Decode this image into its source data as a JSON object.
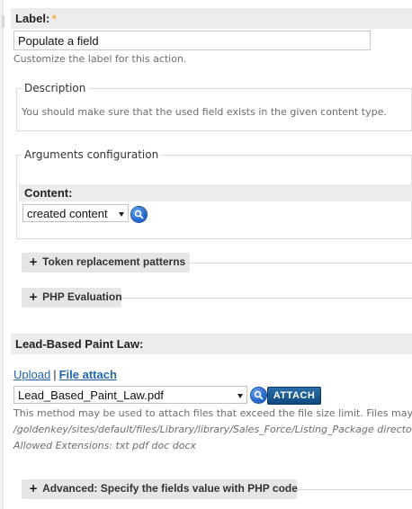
{
  "label_field": {
    "label": "Label:",
    "required_marker": "*",
    "value": "Populate a field",
    "help": "Customize the label for this action."
  },
  "description": {
    "legend": "Description",
    "text": "You should make sure that the used field exists in the given content type."
  },
  "arguments": {
    "legend": "Arguments configuration",
    "content_label": "Content:",
    "content_select_value": "created content"
  },
  "collapsibles": {
    "token": "Token replacement patterns",
    "php_eval": "PHP Evaluation",
    "advanced": "Advanced: Specify the fields value with PHP code"
  },
  "attachment": {
    "section_label": "Lead-Based Paint Law:",
    "upload_link": "Upload",
    "separator": "|",
    "file_attach_link": "File attach",
    "select_value": "Lead_Based_Paint_Law.pdf",
    "attach_button": "ATTACH",
    "help_line1": "This method may be used to attach files that exceed the file size limit. Files may be",
    "help_line2": "/goldenkey/sites/default/files/Library/library/Sales_Force/Listing_Package directory",
    "help_line3": "Allowed Extensions: txt pdf doc docx"
  },
  "icons": {
    "search": "search-icon",
    "expand": "plus-icon",
    "dropdown": "chevron-down-icon"
  },
  "colors": {
    "accent_link": "#2266aa",
    "attach_button": "#1a5a94",
    "required": "#f39c12"
  }
}
